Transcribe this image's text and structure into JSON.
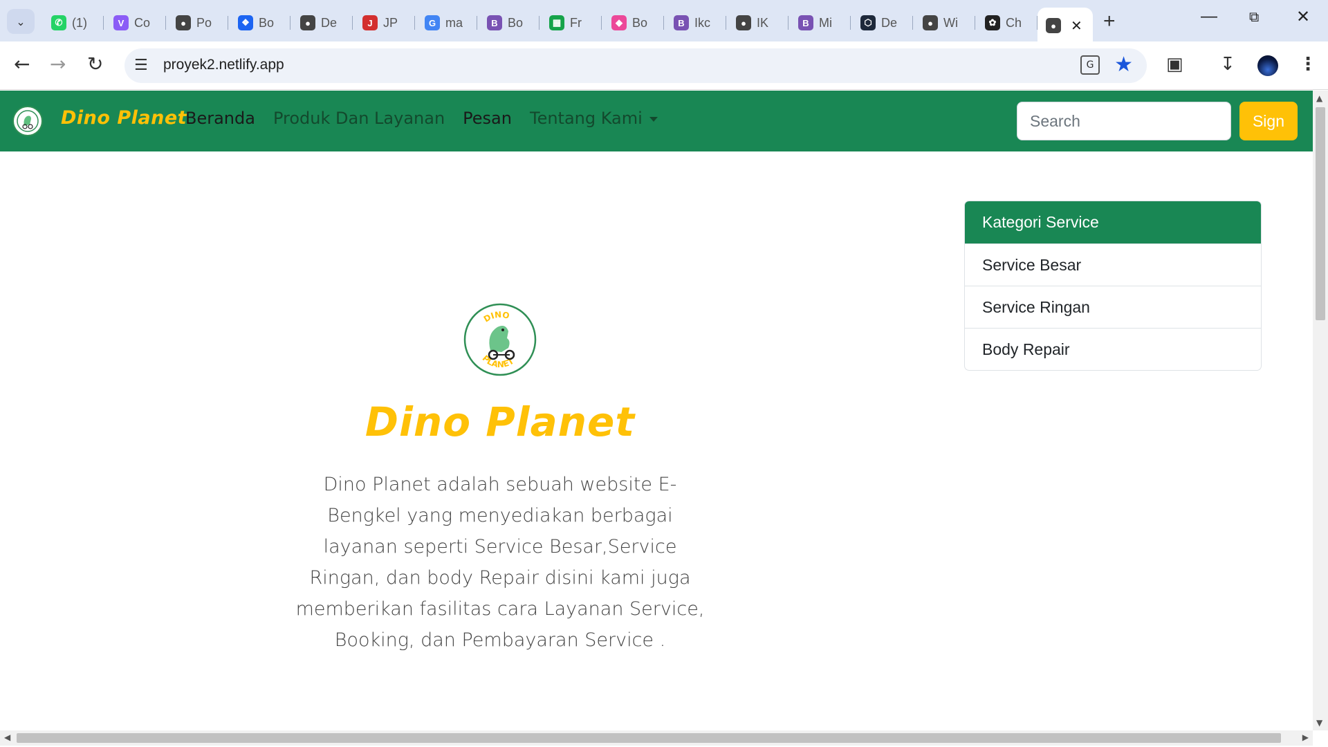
{
  "browser": {
    "tabs": [
      {
        "label": "(1)",
        "icon": "whatsapp-icon",
        "color": "#25d366"
      },
      {
        "label": "Co",
        "icon": "vite-icon",
        "color": "#8b5cf6"
      },
      {
        "label": "Po",
        "icon": "globe-icon",
        "color": "#444444"
      },
      {
        "label": "Bo",
        "icon": "flowbite-icon",
        "color": "#1c64f2"
      },
      {
        "label": "De",
        "icon": "globe-icon",
        "color": "#444444"
      },
      {
        "label": "JP",
        "icon": "jpg-png-icon",
        "color": "#d32f2f"
      },
      {
        "label": "ma",
        "icon": "google-icon",
        "color": "#4285f4"
      },
      {
        "label": "Bo",
        "icon": "bootstrap-icon",
        "color": "#7952b3"
      },
      {
        "label": "Fr",
        "icon": "frame-icon",
        "color": "#16a34a"
      },
      {
        "label": "Bo",
        "icon": "box-icon",
        "color": "#ec4899"
      },
      {
        "label": "Ikc",
        "icon": "bootstrap-icon",
        "color": "#7952b3"
      },
      {
        "label": "IK",
        "icon": "globe-icon",
        "color": "#444444"
      },
      {
        "label": "Mi",
        "icon": "bootstrap-icon",
        "color": "#7952b3"
      },
      {
        "label": "De",
        "icon": "devin-icon",
        "color": "#1e293b"
      },
      {
        "label": "Wi",
        "icon": "globe-icon",
        "color": "#444444"
      },
      {
        "label": "Ch",
        "icon": "openai-icon",
        "color": "#222222"
      }
    ],
    "active_tab_icon": "globe-icon",
    "url": "proyek2.netlify.app"
  },
  "site": {
    "brand": "Dino Planet",
    "nav": [
      "Beranda",
      "Produk Dan Layanan",
      "Pesan",
      "Tentang Kami"
    ],
    "search_placeholder": "Search",
    "sign_label": "Sign",
    "logo_text": "DINO PLANET",
    "colors": {
      "primary": "#198754",
      "accent": "#ffc107"
    }
  },
  "hero": {
    "title": "Dino Planet",
    "description": "Dino Planet adalah sebuah website E-Bengkel yang menyediakan berbagai layanan seperti Service Besar,Service Ringan, dan body Repair disini kami juga memberikan fasilitas cara Layanan Service, Booking, dan Pembayaran Service ."
  },
  "categories": {
    "heading": "Kategori Service",
    "items": [
      "Service Besar",
      "Service Ringan",
      "Body Repair"
    ]
  }
}
